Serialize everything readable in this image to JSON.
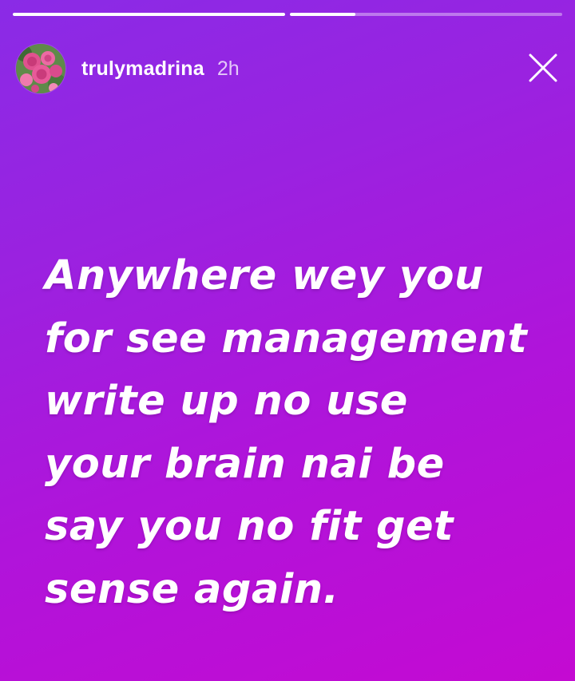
{
  "story": {
    "progress": [
      1.0,
      0.24
    ],
    "background": {
      "start": "#8a2be6",
      "end": "#c40ad2"
    }
  },
  "header": {
    "avatar_icon": "rose-flowers-avatar",
    "username": "trulymadrina",
    "time": "2h",
    "close_icon": "close-icon"
  },
  "content": {
    "lines": [
      "Anywhere wey you",
      "for see management",
      "write up no use",
      "your brain nai be",
      "say you no fit get",
      "sense again."
    ]
  }
}
